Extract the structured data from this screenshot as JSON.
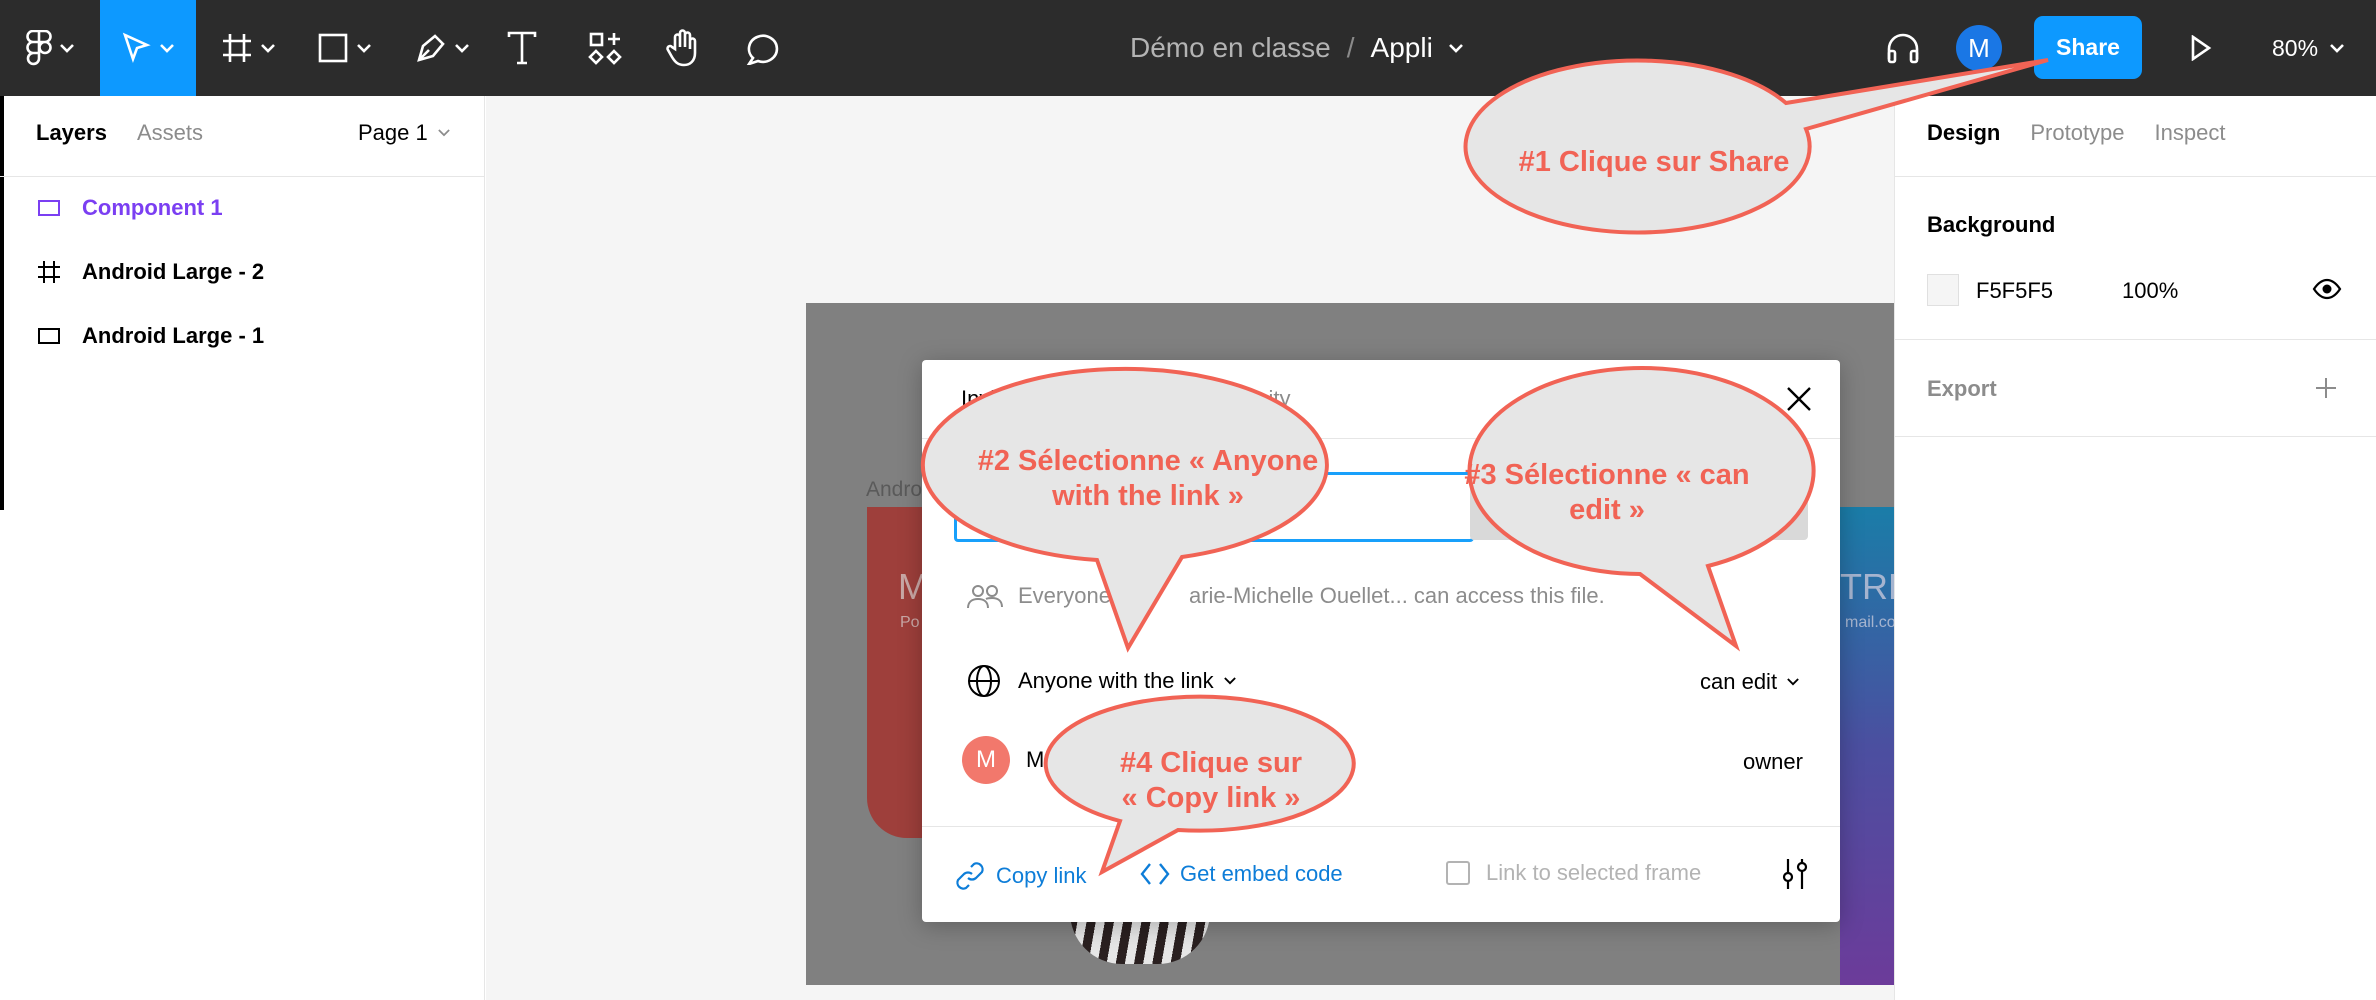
{
  "toolbar": {
    "file_name": "Démo en classe",
    "separator": "/",
    "page_name": "Appli",
    "avatar_initial": "M",
    "share_label": "Share",
    "zoom": "80%"
  },
  "left_panel": {
    "tabs": [
      "Layers",
      "Assets"
    ],
    "page_selector": "Page 1",
    "layers": [
      {
        "name": "Component 1",
        "icon": "component-icon",
        "color": "#7b3ff2"
      },
      {
        "name": "Android Large - 2",
        "icon": "frame-icon",
        "color": "#000000"
      },
      {
        "name": "Android Large - 1",
        "icon": "rectangle-icon",
        "color": "#000000"
      }
    ]
  },
  "right_panel": {
    "tabs": [
      "Design",
      "Prototype",
      "Inspect"
    ],
    "background_title": "Background",
    "background_hex": "F5F5F5",
    "background_opacity": "100%",
    "export_title": "Export"
  },
  "canvas": {
    "frame_label": "Andro",
    "card_text_left": "M",
    "card_sub_left": "Po",
    "card_text_right": "TRE",
    "card_sub_right": "mail.co"
  },
  "modal": {
    "tab_invite": "Invite",
    "tab_partial_1": "P",
    "tab_partial_2": "unity",
    "access_text_1": "Everyone",
    "access_text_2": "arie-Michelle Ouellet... can access this file.",
    "link_access": "Anyone with the link",
    "permission": "can edit",
    "owner_initial": "M",
    "owner_name": "Mari",
    "owner_role": "owner",
    "copy_link": "Copy link",
    "embed_code": "Get embed code",
    "link_selected_frame": "Link to selected frame"
  },
  "callouts": [
    {
      "lines": [
        "#1 Clique sur Share"
      ]
    },
    {
      "lines": [
        "#2 Sélectionne « Anyone",
        "with the link »"
      ]
    },
    {
      "lines": [
        "#3 Sélectionne « can",
        "edit »"
      ]
    },
    {
      "lines": [
        "#4 Clique sur",
        "« Copy link »"
      ]
    }
  ],
  "colors": {
    "accent": "#0d99ff",
    "callout_text": "#f16355",
    "callout_fill": "#e6e6e6",
    "link_blue": "#0d7dd8"
  }
}
